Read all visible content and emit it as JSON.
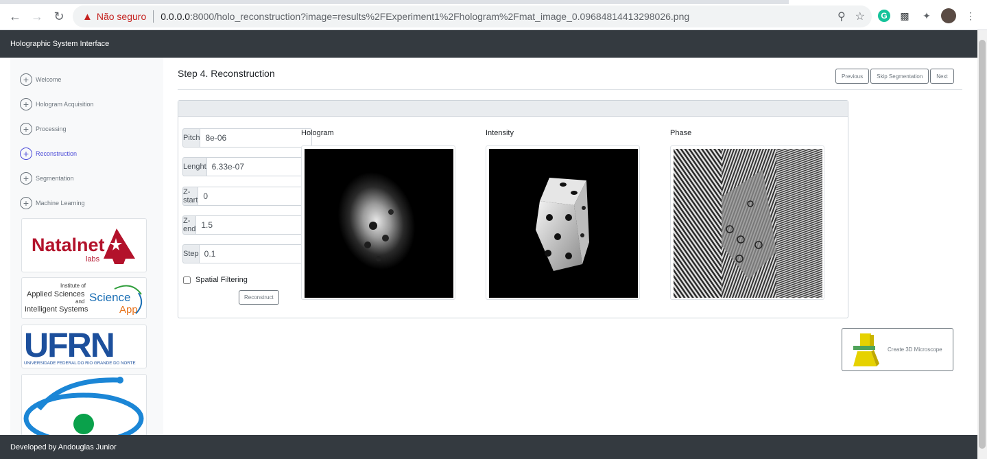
{
  "browser": {
    "security_label": "Não seguro",
    "url_host": "0.0.0.0",
    "url_rest": ":8000/holo_reconstruction?image=results%2FExperiment1%2Fhologram%2Fmat_image_0.09684814413298026.png"
  },
  "navbar": {
    "title": "Holographic System Interface"
  },
  "sidebar": {
    "steps": [
      {
        "label": "Welcome"
      },
      {
        "label": "Hologram Acquisition"
      },
      {
        "label": "Processing"
      },
      {
        "label": "Reconstruction"
      },
      {
        "label": "Segmentation"
      },
      {
        "label": "Machine Learning"
      }
    ],
    "logos": {
      "natalnet": {
        "main": "Natalnet",
        "sub": "labs"
      },
      "science_app": {
        "line1": "Institute of",
        "line2": "Applied Sciences",
        "line3": "and",
        "line4": "Intelligent Systems",
        "brand1": "Science",
        "brand2": "App"
      },
      "ufrn": {
        "main": "UFRN",
        "sub": "UNIVERSIDADE FEDERAL DO RIO GRANDE DO NORTE"
      }
    }
  },
  "main": {
    "title": "Step 4. Reconstruction",
    "buttons": {
      "previous": "Previous",
      "skip": "Skip Segmentation",
      "next": "Next"
    },
    "params": [
      {
        "label": "Pitch",
        "value": "8e-06"
      },
      {
        "label": "Lenght",
        "value": "6.33e-07"
      },
      {
        "label": "Z-start",
        "value": "0"
      },
      {
        "label": "Z-end",
        "value": "1.5"
      },
      {
        "label": "Step",
        "value": "0.1"
      }
    ],
    "spatial_filtering_label": "Spatial Filtering",
    "spatial_filtering_checked": false,
    "reconstruct_label": "Reconstruct",
    "images": {
      "hologram": "Hologram",
      "intensity": "Intensity",
      "phase": "Phase"
    },
    "microscope_label": "Create 3D Microscope"
  },
  "footer": {
    "text": "Developed by Andouglas Junior"
  }
}
